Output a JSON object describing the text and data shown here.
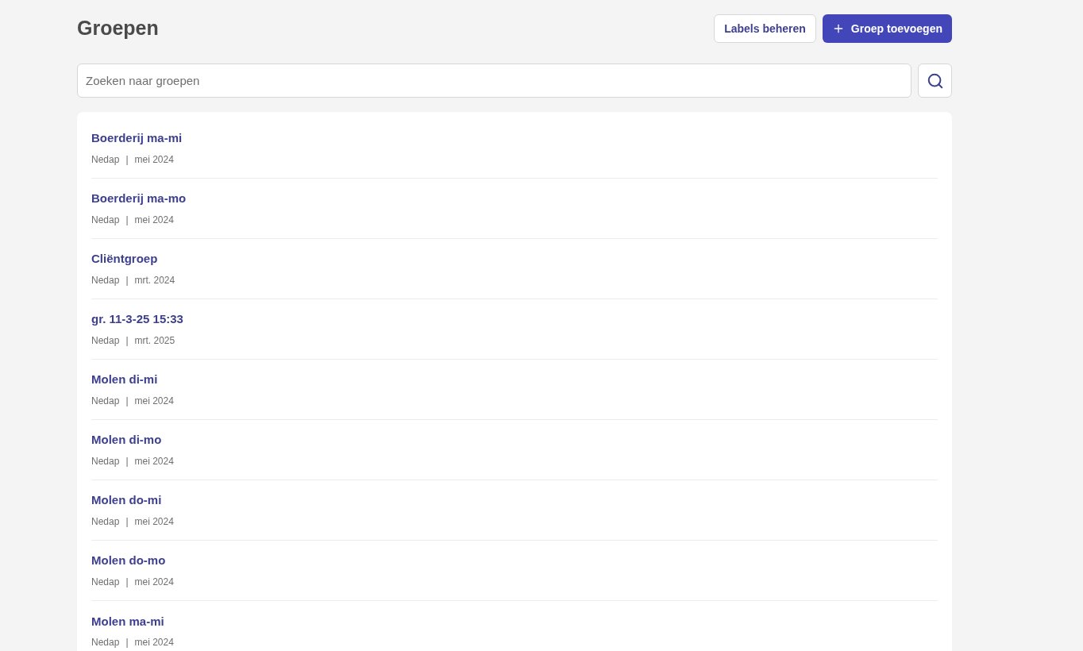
{
  "page": {
    "title": "Groepen"
  },
  "actions": [
    {
      "kind": "secondary",
      "label": "Labels beheren"
    },
    {
      "kind": "primary",
      "label": "Groep toevoegen"
    }
  ],
  "search": {
    "placeholder": "Zoeken naar groepen"
  },
  "groups": [
    {
      "name": "Boerderij ma-mi",
      "organisation": "Nedap",
      "separator": "|",
      "date": "mei 2024"
    },
    {
      "name": "Boerderij ma-mo",
      "organisation": "Nedap",
      "separator": "|",
      "date": "mei 2024"
    },
    {
      "name": "Cliëntgroep",
      "organisation": "Nedap",
      "separator": "|",
      "date": "mrt. 2024"
    },
    {
      "name": "gr. 11-3-25 15:33",
      "organisation": "Nedap",
      "separator": "|",
      "date": "mrt. 2025"
    },
    {
      "name": "Molen di-mi",
      "organisation": "Nedap",
      "separator": "|",
      "date": "mei 2024"
    },
    {
      "name": "Molen di-mo",
      "organisation": "Nedap",
      "separator": "|",
      "date": "mei 2024"
    },
    {
      "name": "Molen do-mi",
      "organisation": "Nedap",
      "separator": "|",
      "date": "mei 2024"
    },
    {
      "name": "Molen do-mo",
      "organisation": "Nedap",
      "separator": "|",
      "date": "mei 2024"
    },
    {
      "name": "Molen ma-mi",
      "organisation": "Nedap",
      "separator": "|",
      "date": "mei 2024"
    }
  ]
}
